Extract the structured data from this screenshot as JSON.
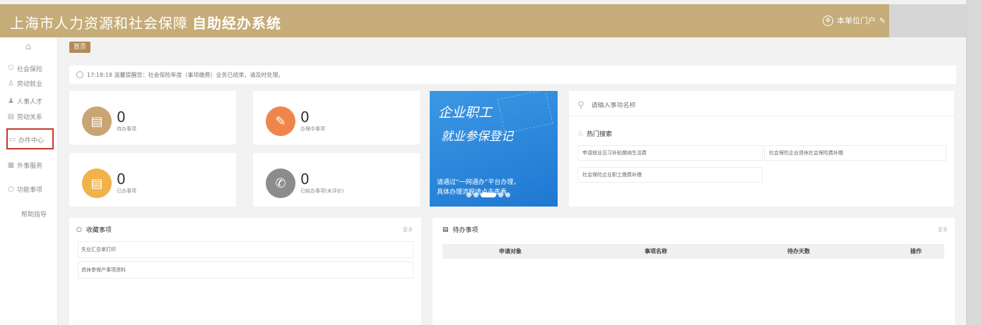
{
  "header": {
    "title_main": "上海市人力资源和社会保障",
    "title_bold": "自助经办系统",
    "portal_label": "本单位门户"
  },
  "sidebar": {
    "items": [
      {
        "label": "社会保险",
        "icon": "shield-icon"
      },
      {
        "label": "劳动就业",
        "icon": "person-icon"
      },
      {
        "label": "人事人才",
        "icon": "user-icon"
      },
      {
        "label": "劳动关系",
        "icon": "document-icon"
      },
      {
        "label": "办件中心",
        "icon": "folder-icon"
      },
      {
        "label": "外事服务",
        "icon": "list-icon"
      },
      {
        "label": "功能事项",
        "icon": "circle-icon"
      },
      {
        "label": "帮助指导",
        "icon": ""
      }
    ]
  },
  "breadcrumb": "首页",
  "notice": "17:18:18 温馨提醒您：社会保险年度（事项缴费）业务已结束，请及时处理。",
  "stats": [
    {
      "value": "0",
      "label": "待办事项",
      "color": "#c9a574",
      "icon": "document-icon"
    },
    {
      "value": "0",
      "label": "办理中事项",
      "color": "#ef8649",
      "icon": "edit-icon"
    },
    {
      "value": "0",
      "label": "已办事项",
      "color": "#f1b24a",
      "icon": "document-icon"
    },
    {
      "value": "0",
      "label": "已结办事项(未评价)",
      "color": "#8c8c8c",
      "icon": "phone-icon"
    }
  ],
  "banner": {
    "line1": "企业职工",
    "line2": "就业参保登记",
    "sub1": "请通过“一网通办”平台办理，",
    "sub2": "具体办理流程请点击查看"
  },
  "search": {
    "placeholder": "请输入事项名称",
    "hot_title": "热门搜索",
    "hot_items": [
      "申请就业见习补贴缴纳生活费",
      "社会保险企业退休社会保险费补缴",
      "社会保险企业职工缴费补缴"
    ]
  },
  "favorites": {
    "title": "收藏事项",
    "more": "更多",
    "items": [
      "失业汇总单打印",
      "退休参保产事项资料"
    ]
  },
  "todo": {
    "title": "待办事项",
    "more": "更多",
    "columns": [
      "申请对象",
      "事项名称",
      "待办天数",
      "操作"
    ]
  }
}
